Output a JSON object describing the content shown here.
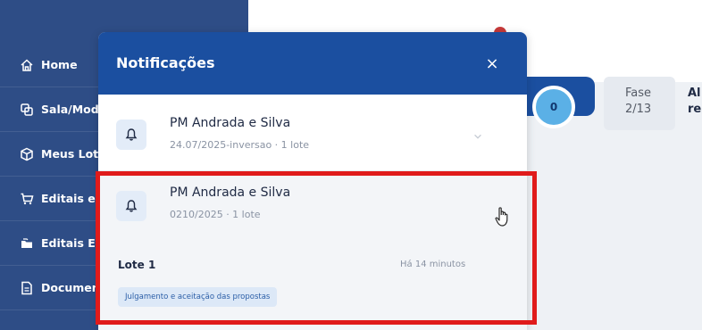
{
  "sidebar": {
    "items": [
      {
        "label": "Home",
        "icon": "home-icon"
      },
      {
        "label": "Sala/Modo",
        "icon": "switch-icon"
      },
      {
        "label": "Meus Lotes",
        "icon": "box-icon"
      },
      {
        "label": "Editais e",
        "icon": "cart-icon"
      },
      {
        "label": "Editais E",
        "icon": "folders-icon"
      },
      {
        "label": "Documentos",
        "icon": "document-icon"
      }
    ]
  },
  "header": {
    "counter": "0",
    "fase_label": "Fase",
    "fase_value": "2/13",
    "cut_text_1": "Al",
    "cut_text_2": "re"
  },
  "notifications": {
    "title": "Notificações",
    "close_label": "×",
    "items": [
      {
        "title": "PM Andrada e Silva",
        "subtitle": "24.07/2025-inversao · 1 lote"
      },
      {
        "title": "PM Andrada e Silva",
        "subtitle": "0210/2025 · 1 lote",
        "lote": "Lote 1",
        "time": "Há 14 minutos",
        "tag": "Julgamento e aceitação das propostas"
      }
    ]
  },
  "colors": {
    "sidebar": "#2e4d86",
    "header_blue": "#1b4fa0",
    "highlight": "#e01b1b"
  }
}
